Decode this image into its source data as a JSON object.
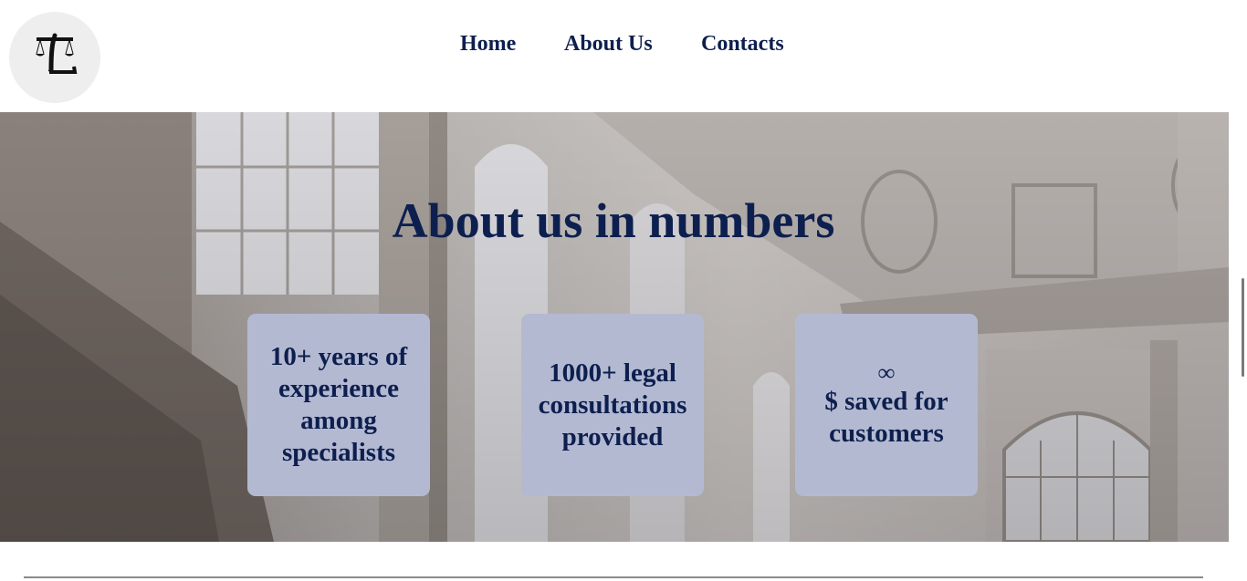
{
  "brand": {
    "logo_text": "TL",
    "accent_color": "#0d1f4e"
  },
  "nav": {
    "items": [
      {
        "label": "Home"
      },
      {
        "label": "About Us"
      },
      {
        "label": "Contacts"
      }
    ]
  },
  "hero": {
    "title": "About us in numbers"
  },
  "stats": [
    {
      "symbol": "",
      "text": "10+ years of experience among specialists"
    },
    {
      "symbol": "",
      "text": "1000+ legal consultations provided"
    },
    {
      "symbol": "∞",
      "text": "$ saved for customers"
    }
  ],
  "colors": {
    "card_bg": "#b4b9d2",
    "text": "#0d1f4e",
    "logo_bg": "#eeeeee"
  }
}
